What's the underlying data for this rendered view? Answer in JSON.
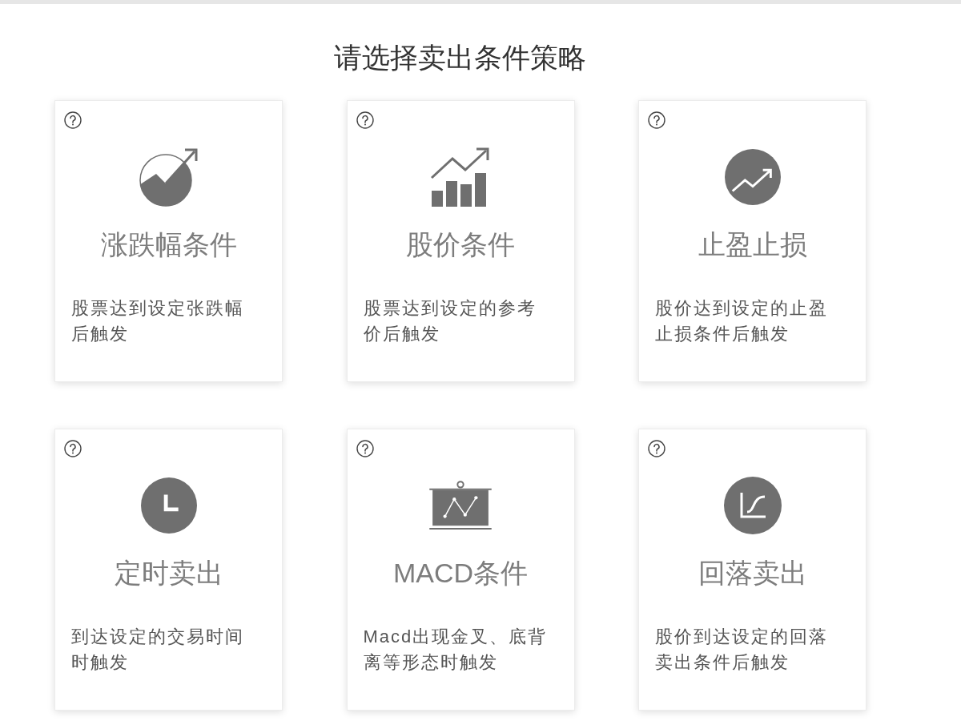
{
  "heading": "请选择卖出条件策略",
  "strategies": [
    {
      "kind": "change",
      "title": "涨跌幅条件",
      "description": "股票达到设定张跌幅后触发"
    },
    {
      "kind": "price",
      "title": "股价条件",
      "description": "股票达到设定的参考价后触发"
    },
    {
      "kind": "profit-loss",
      "title": "止盈止损",
      "description": "股价达到设定的止盈止损条件后触发"
    },
    {
      "kind": "timed",
      "title": "定时卖出",
      "description": "到达设定的交易时间时触发"
    },
    {
      "kind": "macd",
      "title": "MACD条件",
      "description": "Macd出现金叉、底背离等形态时触发"
    },
    {
      "kind": "pullback",
      "title": "回落卖出",
      "description": "股价到达设定的回落卖出条件后触发"
    }
  ]
}
